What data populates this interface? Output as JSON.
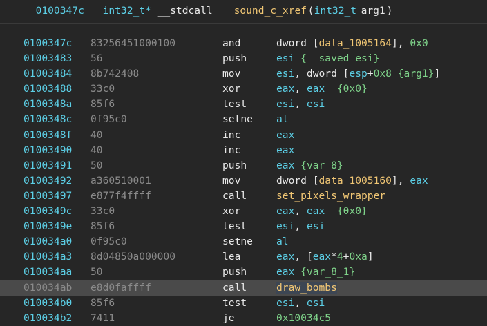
{
  "header": {
    "address": "0100347c",
    "return_type": "int32_t*",
    "calling_convention": "__stdcall",
    "function_name": "sound_c_xref",
    "open_paren": "(",
    "param_type": "int32_t",
    "param_name": "arg1",
    "close_paren": ")"
  },
  "lines": [
    {
      "address": "0100347c",
      "bytes": "83256451000100",
      "mnemonic": "and",
      "operands": [
        {
          "t": "txt",
          "v": "dword ["
        },
        {
          "t": "sym",
          "v": "data_1005164"
        },
        {
          "t": "txt",
          "v": "], "
        },
        {
          "t": "num",
          "v": "0x0"
        }
      ]
    },
    {
      "address": "01003483",
      "bytes": "56",
      "mnemonic": "push",
      "operands": [
        {
          "t": "reg",
          "v": "esi"
        },
        {
          "t": "txt",
          "v": " "
        },
        {
          "t": "hint",
          "v": "{__saved_esi}"
        }
      ]
    },
    {
      "address": "01003484",
      "bytes": "8b742408",
      "mnemonic": "mov",
      "operands": [
        {
          "t": "reg",
          "v": "esi"
        },
        {
          "t": "txt",
          "v": ", dword ["
        },
        {
          "t": "reg",
          "v": "esp"
        },
        {
          "t": "txt",
          "v": "+"
        },
        {
          "t": "num",
          "v": "0x8"
        },
        {
          "t": "txt",
          "v": " "
        },
        {
          "t": "hint",
          "v": "{arg1}"
        },
        {
          "t": "txt",
          "v": "]"
        }
      ]
    },
    {
      "address": "01003488",
      "bytes": "33c0",
      "mnemonic": "xor",
      "operands": [
        {
          "t": "reg",
          "v": "eax"
        },
        {
          "t": "txt",
          "v": ", "
        },
        {
          "t": "reg",
          "v": "eax"
        },
        {
          "t": "txt",
          "v": "  "
        },
        {
          "t": "hint",
          "v": "{0x0}"
        }
      ]
    },
    {
      "address": "0100348a",
      "bytes": "85f6",
      "mnemonic": "test",
      "operands": [
        {
          "t": "reg",
          "v": "esi"
        },
        {
          "t": "txt",
          "v": ", "
        },
        {
          "t": "reg",
          "v": "esi"
        }
      ]
    },
    {
      "address": "0100348c",
      "bytes": "0f95c0",
      "mnemonic": "setne",
      "operands": [
        {
          "t": "reg",
          "v": "al"
        }
      ]
    },
    {
      "address": "0100348f",
      "bytes": "40",
      "mnemonic": "inc",
      "operands": [
        {
          "t": "reg",
          "v": "eax"
        }
      ]
    },
    {
      "address": "01003490",
      "bytes": "40",
      "mnemonic": "inc",
      "operands": [
        {
          "t": "reg",
          "v": "eax"
        }
      ]
    },
    {
      "address": "01003491",
      "bytes": "50",
      "mnemonic": "push",
      "operands": [
        {
          "t": "reg",
          "v": "eax"
        },
        {
          "t": "txt",
          "v": " "
        },
        {
          "t": "hint",
          "v": "{var_8}"
        }
      ]
    },
    {
      "address": "01003492",
      "bytes": "a360510001",
      "mnemonic": "mov",
      "operands": [
        {
          "t": "txt",
          "v": "dword ["
        },
        {
          "t": "sym",
          "v": "data_1005160"
        },
        {
          "t": "txt",
          "v": "], "
        },
        {
          "t": "reg",
          "v": "eax"
        }
      ]
    },
    {
      "address": "01003497",
      "bytes": "e877f4ffff",
      "mnemonic": "call",
      "operands": [
        {
          "t": "sym",
          "v": "set_pixels_wrapper"
        }
      ]
    },
    {
      "address": "0100349c",
      "bytes": "33c0",
      "mnemonic": "xor",
      "operands": [
        {
          "t": "reg",
          "v": "eax"
        },
        {
          "t": "txt",
          "v": ", "
        },
        {
          "t": "reg",
          "v": "eax"
        },
        {
          "t": "txt",
          "v": "  "
        },
        {
          "t": "hint",
          "v": "{0x0}"
        }
      ]
    },
    {
      "address": "0100349e",
      "bytes": "85f6",
      "mnemonic": "test",
      "operands": [
        {
          "t": "reg",
          "v": "esi"
        },
        {
          "t": "txt",
          "v": ", "
        },
        {
          "t": "reg",
          "v": "esi"
        }
      ]
    },
    {
      "address": "010034a0",
      "bytes": "0f95c0",
      "mnemonic": "setne",
      "operands": [
        {
          "t": "reg",
          "v": "al"
        }
      ]
    },
    {
      "address": "010034a3",
      "bytes": "8d04850a000000",
      "mnemonic": "lea",
      "operands": [
        {
          "t": "reg",
          "v": "eax"
        },
        {
          "t": "txt",
          "v": ", ["
        },
        {
          "t": "reg",
          "v": "eax"
        },
        {
          "t": "txt",
          "v": "*"
        },
        {
          "t": "num",
          "v": "4"
        },
        {
          "t": "txt",
          "v": "+"
        },
        {
          "t": "num",
          "v": "0xa"
        },
        {
          "t": "txt",
          "v": "]"
        }
      ]
    },
    {
      "address": "010034aa",
      "bytes": "50",
      "mnemonic": "push",
      "operands": [
        {
          "t": "reg",
          "v": "eax"
        },
        {
          "t": "txt",
          "v": " "
        },
        {
          "t": "hint",
          "v": "{var_8_1}"
        }
      ]
    },
    {
      "address": "010034ab",
      "bytes": "e8d0faffff",
      "mnemonic": "call",
      "selected": true,
      "operands": [
        {
          "t": "sym",
          "v": "draw_bombs",
          "hl": true
        }
      ]
    },
    {
      "address": "010034b0",
      "bytes": "85f6",
      "mnemonic": "test",
      "operands": [
        {
          "t": "reg",
          "v": "esi"
        },
        {
          "t": "txt",
          "v": ", "
        },
        {
          "t": "reg",
          "v": "esi"
        }
      ]
    },
    {
      "address": "010034b2",
      "bytes": "7411",
      "mnemonic": "je",
      "operands": [
        {
          "t": "num",
          "v": "0x10034c5"
        }
      ]
    }
  ],
  "colors": {
    "background": "#262626",
    "address": "#5ccfe6",
    "register": "#5ccfe6",
    "number": "#7fd38a",
    "symbol": "#f0c674",
    "bytes": "#8a8a8a",
    "selected_row": "#4a4a4a"
  }
}
